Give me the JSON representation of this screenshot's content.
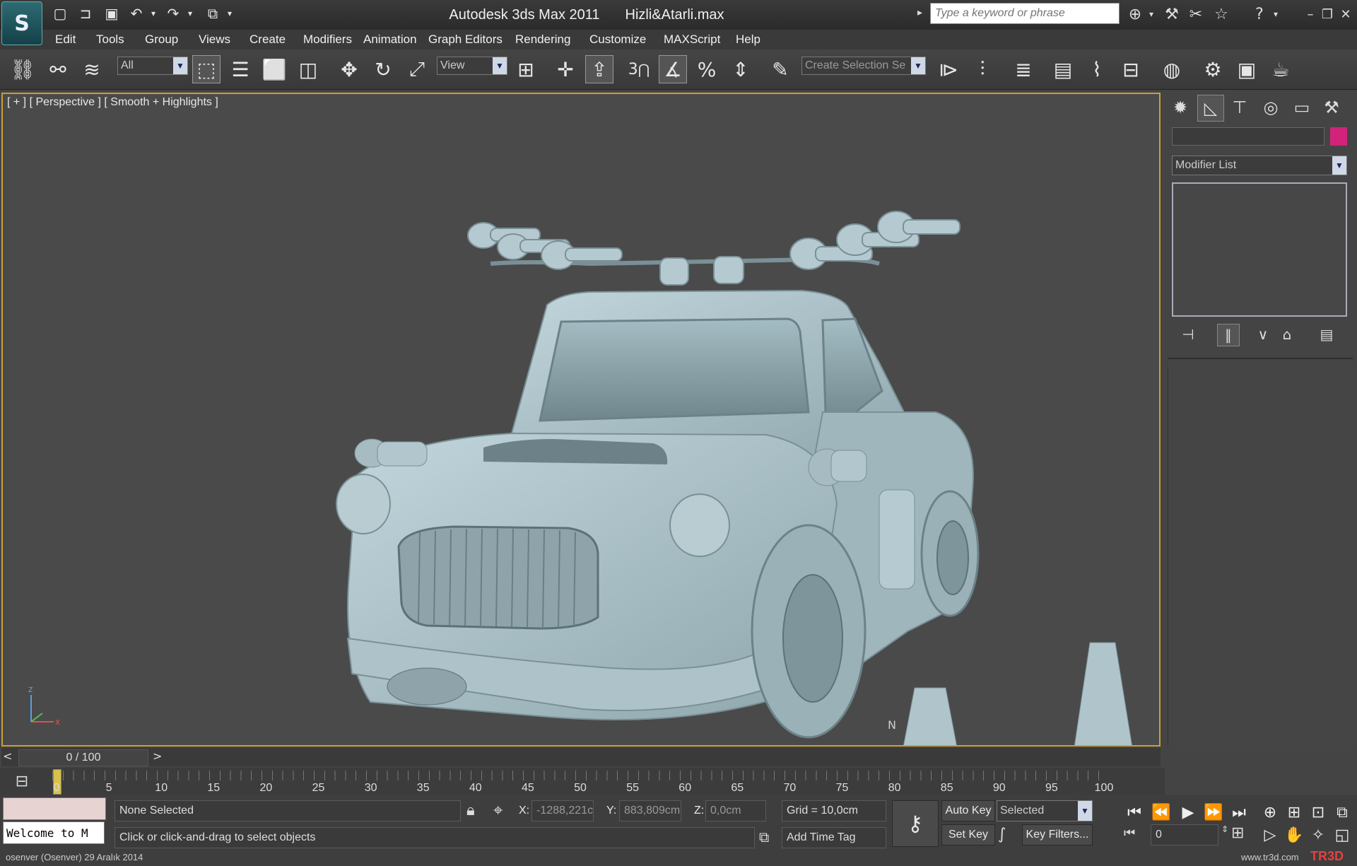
{
  "titlebar": {
    "app_title": "Autodesk 3ds Max  2011",
    "file_name": "Hizli&Atarli.max",
    "search_placeholder": "Type a keyword or phrase"
  },
  "menu": [
    "Edit",
    "Tools",
    "Group",
    "Views",
    "Create",
    "Modifiers",
    "Animation",
    "Graph Editors",
    "Rendering",
    "Customize",
    "MAXScript",
    "Help"
  ],
  "toolbar": {
    "selection_filter": "All",
    "ref_coord": "View",
    "spinner_snap": "3",
    "named_selection": "Create Selection Se"
  },
  "viewport": {
    "label": "[ + ] [ Perspective ] [ Smooth + Highlights ]",
    "compass_label": "N",
    "axis_x": "x",
    "axis_z": "z"
  },
  "command_panel": {
    "modifier_list": "Modifier List",
    "color": "#d2237a"
  },
  "timeline": {
    "frame_display": "0 / 100",
    "ticks": [
      "0",
      "5",
      "10",
      "15",
      "20",
      "25",
      "30",
      "35",
      "40",
      "45",
      "50",
      "55",
      "60",
      "65",
      "70",
      "75",
      "80",
      "85",
      "90",
      "95",
      "100"
    ]
  },
  "status": {
    "selection_status": "None Selected",
    "prompt": "Click or click-and-drag to select objects",
    "maxscript_listener": "Welcome to M",
    "x_label": "X:",
    "x_value": "-1288,221c",
    "y_label": "Y:",
    "y_value": "883,809cm",
    "z_label": "Z:",
    "z_value": "0,0cm",
    "grid": "Grid = 10,0cm",
    "add_time_tag": "Add Time Tag",
    "auto_key": "Auto Key",
    "set_key": "Set Key",
    "key_mode": "Selected",
    "key_filters": "Key Filters...",
    "current_frame": "0",
    "user_info": "osenver (Osenver)  29 Aralık 2014",
    "watermark_url": "www.tr3d.com",
    "watermark_logo": "TR3D"
  }
}
